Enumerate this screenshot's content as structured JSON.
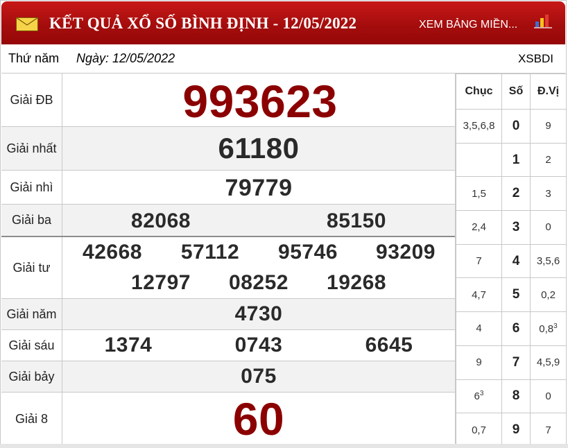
{
  "header": {
    "title": "KẾT QUẢ XỔ SỐ BÌNH ĐỊNH - 12/05/2022",
    "link": "XEM BẢNG MIỀN...",
    "mail_icon": "envelope-icon",
    "chart_icon": "bar-chart-icon",
    "colors": {
      "header": "#b01010",
      "number_highlight": "#8b0000"
    }
  },
  "datebar": {
    "day_of_week": "Thứ năm",
    "date": "Ngày: 12/05/2022",
    "code": "XSBDI"
  },
  "prizes": [
    {
      "label": "Giải ĐB",
      "numbers": [
        "993623"
      ]
    },
    {
      "label": "Giải nhất",
      "numbers": [
        "61180"
      ]
    },
    {
      "label": "Giải nhì",
      "numbers": [
        "79779"
      ]
    },
    {
      "label": "Giải ba",
      "numbers": [
        "82068",
        "85150"
      ]
    },
    {
      "label": "Giải tư",
      "numbers": [
        "42668",
        "57112",
        "95746",
        "93209",
        "12797",
        "08252",
        "19268"
      ]
    },
    {
      "label": "Giải năm",
      "numbers": [
        "4730"
      ]
    },
    {
      "label": "Giải sáu",
      "numbers": [
        "1374",
        "0743",
        "6645"
      ]
    },
    {
      "label": "Giải bảy",
      "numbers": [
        "075"
      ]
    },
    {
      "label": "Giải 8",
      "numbers": [
        "60"
      ]
    }
  ],
  "loto": {
    "headers": [
      "Chục",
      "Số",
      "Đ.Vị"
    ],
    "rows": [
      {
        "chuc": "3,5,6,8",
        "so": "0",
        "dvi": "9"
      },
      {
        "chuc": "",
        "so": "1",
        "dvi": "2"
      },
      {
        "chuc": "1,5",
        "so": "2",
        "dvi": "3"
      },
      {
        "chuc": "2,4",
        "so": "3",
        "dvi": "0"
      },
      {
        "chuc": "7",
        "so": "4",
        "dvi": "3,5,6"
      },
      {
        "chuc": "4,7",
        "so": "5",
        "dvi": "0,2"
      },
      {
        "chuc": "4",
        "so": "6",
        "dvi": "0,8",
        "dvi_sup": "3"
      },
      {
        "chuc": "9",
        "so": "7",
        "dvi": "4,5,9"
      },
      {
        "chuc": "6",
        "chuc_sup": "3",
        "so": "8",
        "dvi": "0"
      },
      {
        "chuc": "0,7",
        "so": "9",
        "dvi": "7"
      }
    ]
  }
}
